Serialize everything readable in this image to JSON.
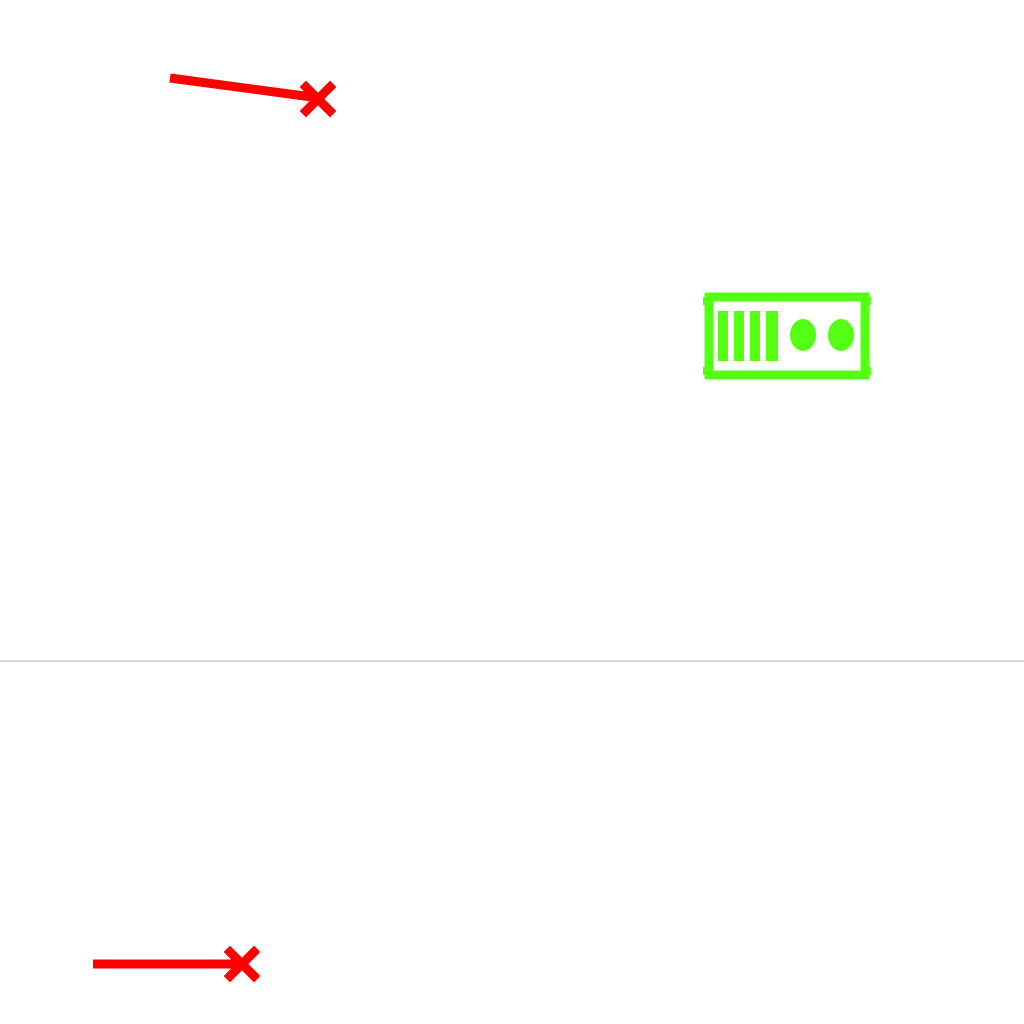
{
  "scene": {
    "background_color": "#ffffff",
    "divider_color": "#b4b4b4",
    "objects": [
      {
        "id": "enemy-ship-top",
        "icon": "red-missile-with-x-head-icon",
        "color": "#ff0000"
      },
      {
        "id": "player-tank",
        "icon": "green-tank-icon",
        "color": "#55ff14"
      },
      {
        "id": "enemy-ship-bottom",
        "icon": "red-missile-with-x-head-icon",
        "color": "#ff0000"
      }
    ]
  }
}
